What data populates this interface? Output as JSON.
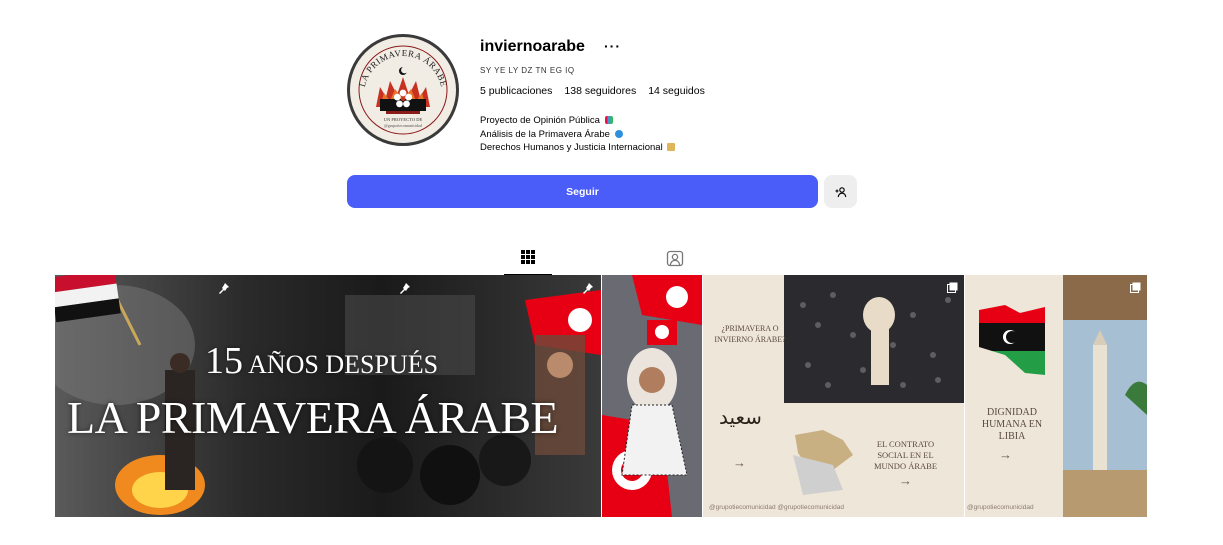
{
  "profile": {
    "username": "inviernoarabe",
    "more_icon": "···",
    "country_codes": "SY YE LY DZ TN EG IQ",
    "stats": {
      "publications": "5 publicaciones",
      "followers": "138 seguidores",
      "following": "14 seguidos"
    },
    "bio": [
      "Proyecto de Opinión Pública",
      "Análisis de la Primavera Árabe",
      "Derechos Humanos y Justicia Internacional"
    ],
    "avatar": {
      "top_text": "LA PRIMAVERA ÁRABE",
      "small_text_1": "UN PROYECTO DE",
      "small_text_2": "@grupotiecomunicidad"
    }
  },
  "actions": {
    "follow_label": "Seguir",
    "add_user_icon": "add-user-icon"
  },
  "tabs": [
    {
      "icon": "grid-icon",
      "active": true
    },
    {
      "icon": "tagged-icon",
      "active": false
    }
  ],
  "posts": {
    "hero": {
      "line1_number": "15",
      "line1_text": "AÑOS DESPUÉS",
      "line2": "LA PRIMAVERA ÁRABE"
    },
    "carousel1": {
      "heading": "¿PRIMAVERA O INVIERNO ÁRABE?",
      "title": "EL CONTRATO SOCIAL EN EL MUNDO ÁRABE",
      "calligraphy": "سعيد",
      "arrow": "→",
      "footer": "@grupotiecomunicidad @grupotiecomunicidad"
    },
    "carousel2": {
      "title": "DIGNIDAD HUMANA EN LIBIA",
      "arrow": "→",
      "footer": "@grupotiecomunicidad"
    }
  },
  "colors": {
    "primary_button": "#4a5df9",
    "beige": "#efe6da",
    "tunisia_red": "#e70013"
  }
}
